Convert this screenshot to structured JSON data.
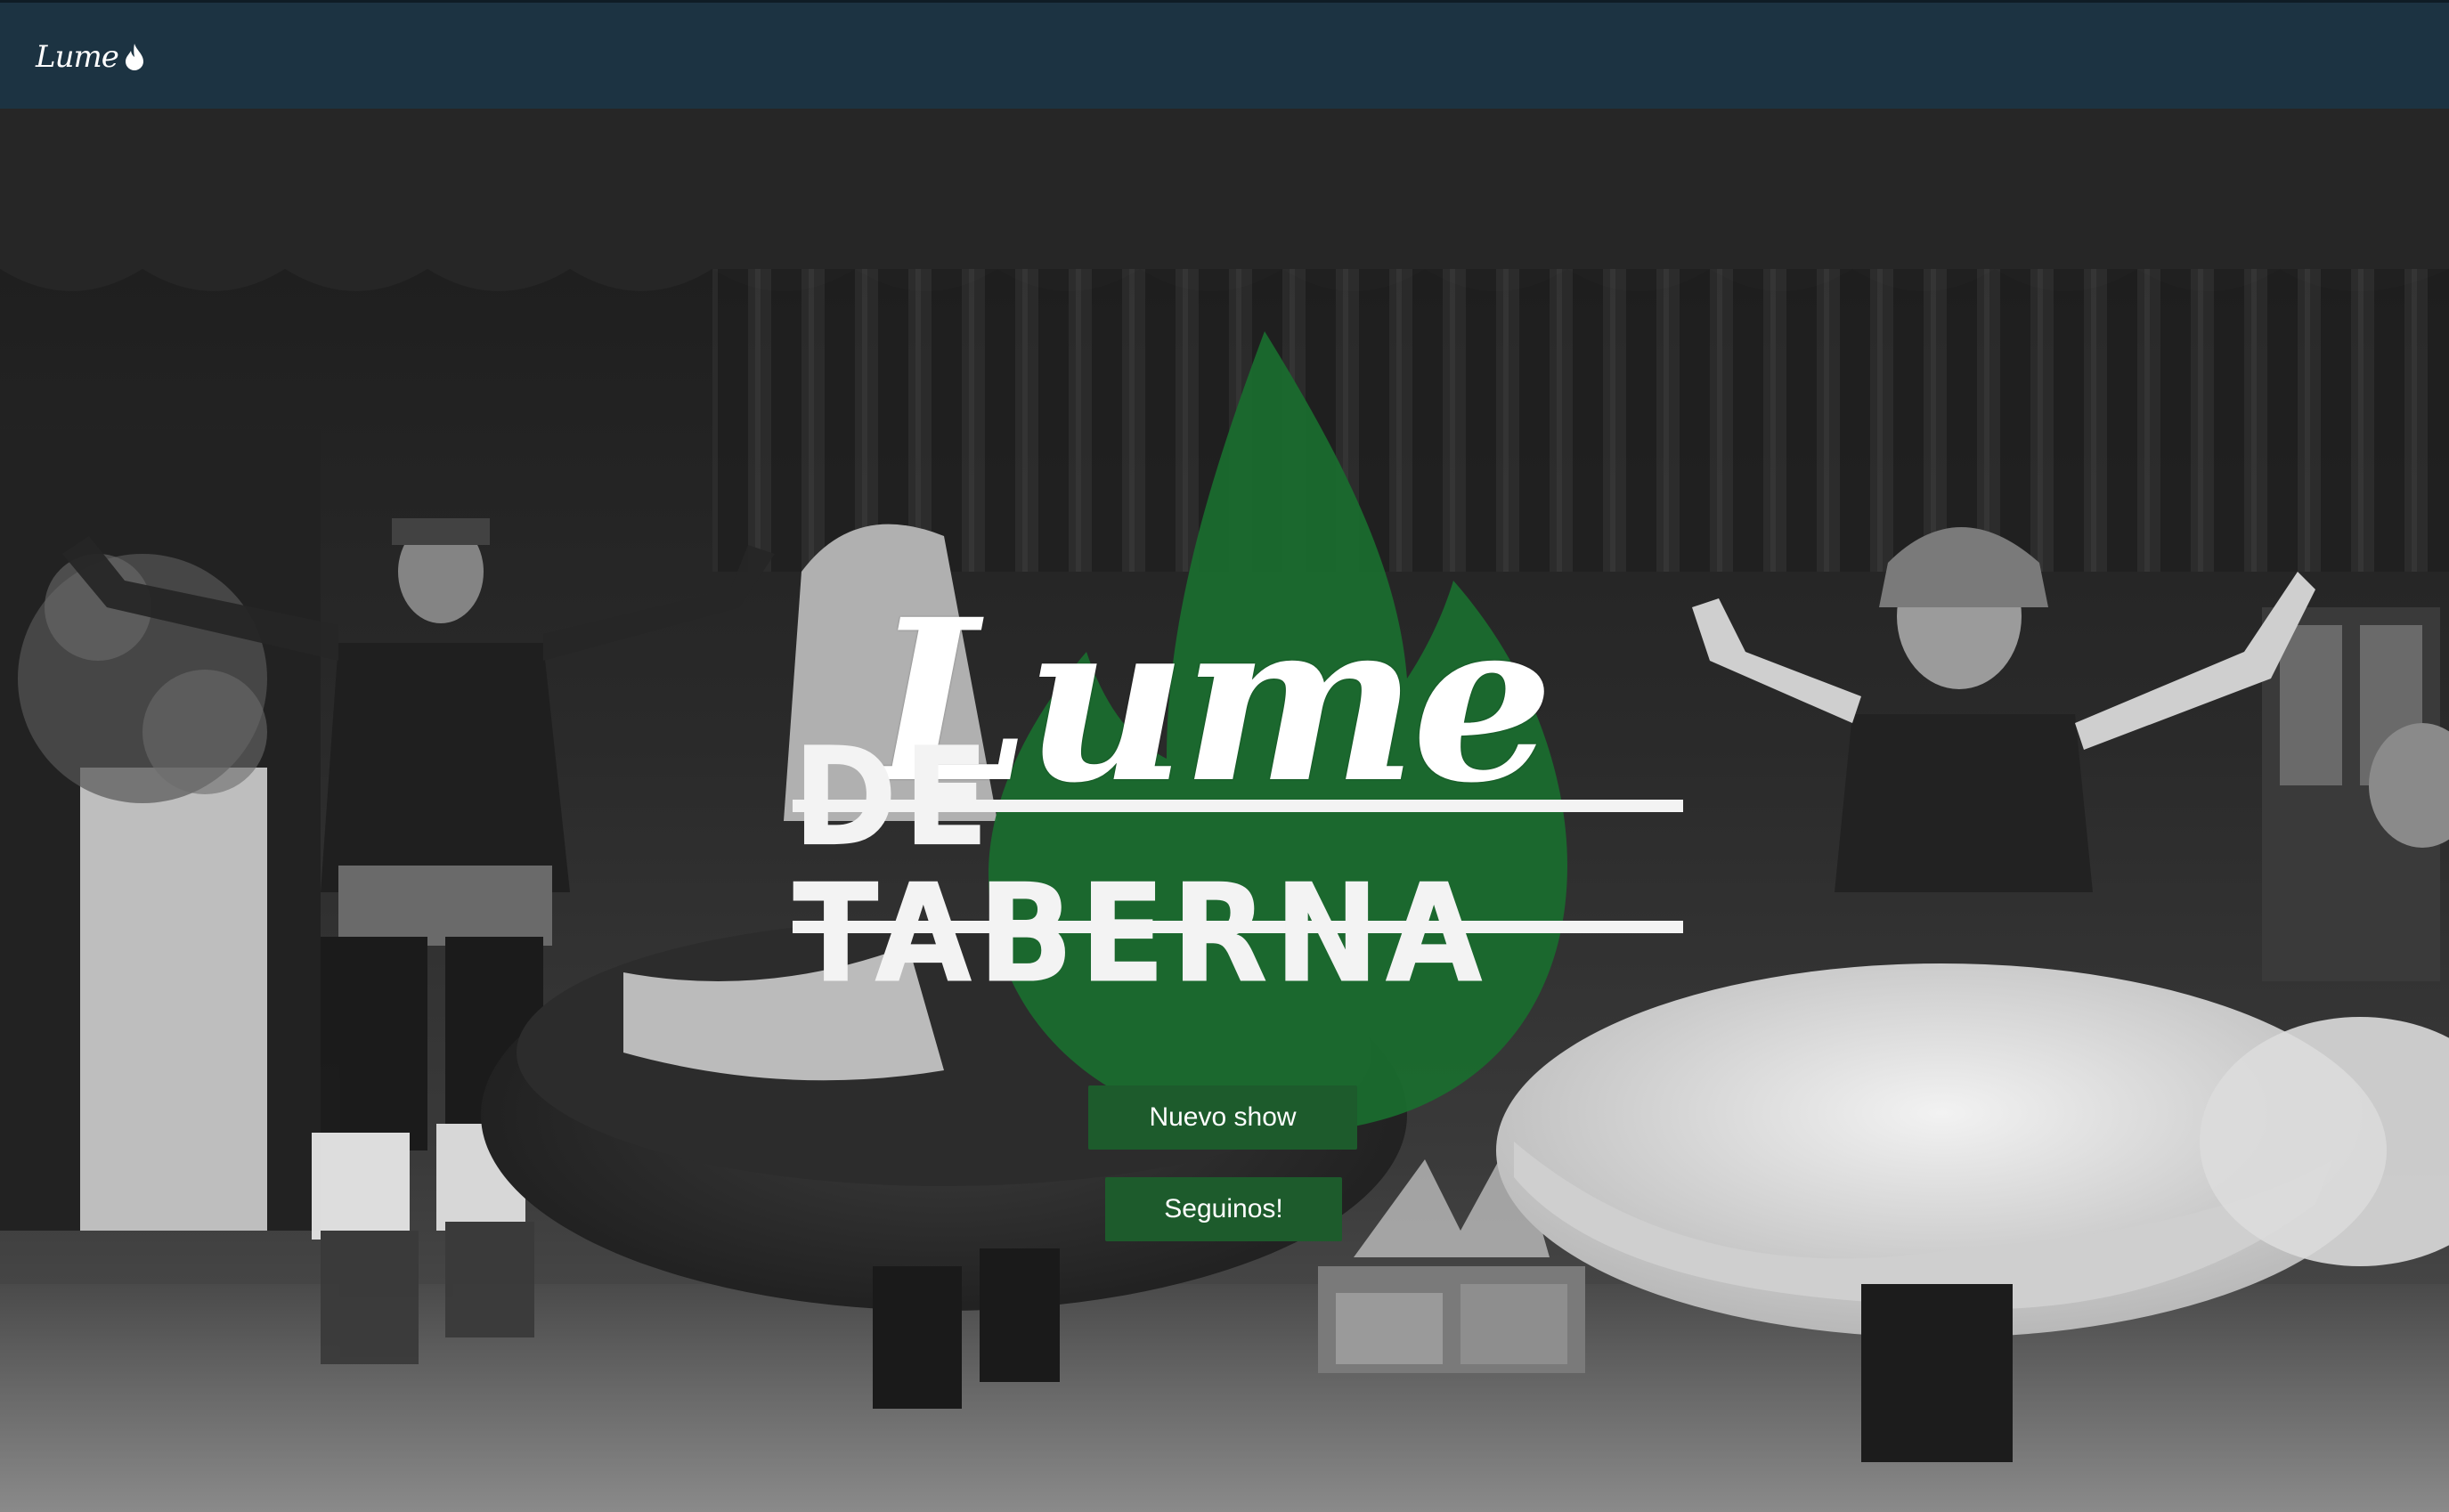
{
  "navbar": {
    "brand_text": "Lume",
    "brand_icon": "flame-icon",
    "background": "#1c3342"
  },
  "hero": {
    "background_image": "folk-dancers-stage-photo",
    "logo": {
      "script_text": "Lume",
      "subtitle_text": "DE TABERNA",
      "flame_color": "#1a6b2e"
    },
    "buttons": [
      {
        "label": "Nuevo show"
      },
      {
        "label": "Seguinos!"
      }
    ],
    "button_color": "#1d5b2c"
  }
}
